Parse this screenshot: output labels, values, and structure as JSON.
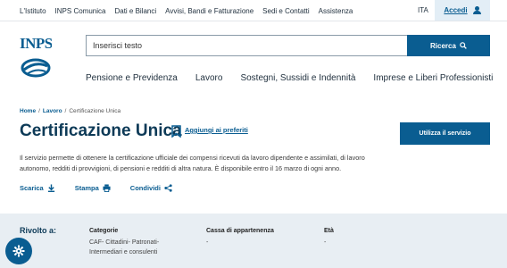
{
  "topbar": {
    "links": [
      "L'Istituto",
      "INPS Comunica",
      "Dati e Bilanci",
      "Avvisi, Bandi e Fatturazione",
      "Sedi e Contatti",
      "Assistenza"
    ],
    "lang": "ITA",
    "login_label": "Accedi"
  },
  "header": {
    "search_placeholder": "Inserisci testo",
    "search_button": "Ricerca",
    "nav": [
      "Pensione e Previdenza",
      "Lavoro",
      "Sostegni, Sussidi e Indennità",
      "Imprese e Liberi Professionisti"
    ]
  },
  "breadcrumb": {
    "home": "Home",
    "section": "Lavoro",
    "current": "Certificazione Unica"
  },
  "page": {
    "title": "Certificazione Unica",
    "favorite_label": "Aggiungi ai preferiti",
    "use_service": "Utilizza il servizio",
    "description": "Il servizio permette di ottenere la certificazione ufficiale dei compensi ricevuti da lavoro dipendente e assimilati, di lavoro autonomo, redditi di provvigioni, di pensioni e redditi di altra natura. È disponibile entro il 16 marzo di ogni anno.",
    "actions": {
      "download": "Scarica",
      "print": "Stampa",
      "share": "Condividi"
    }
  },
  "target": {
    "heading": "Rivolto a:",
    "categorie_label": "Categorie",
    "categorie_line1": "CAF- Cittadini- Patronati-",
    "categorie_line2": "Intermediari e consulenti",
    "cassa_label": "Cassa di appartenenza",
    "cassa_value": "-",
    "eta_label": "Età",
    "eta_value": "-"
  },
  "colors": {
    "primary": "#0a5d91",
    "title": "#0d3a57",
    "band": "#e8eef3"
  }
}
